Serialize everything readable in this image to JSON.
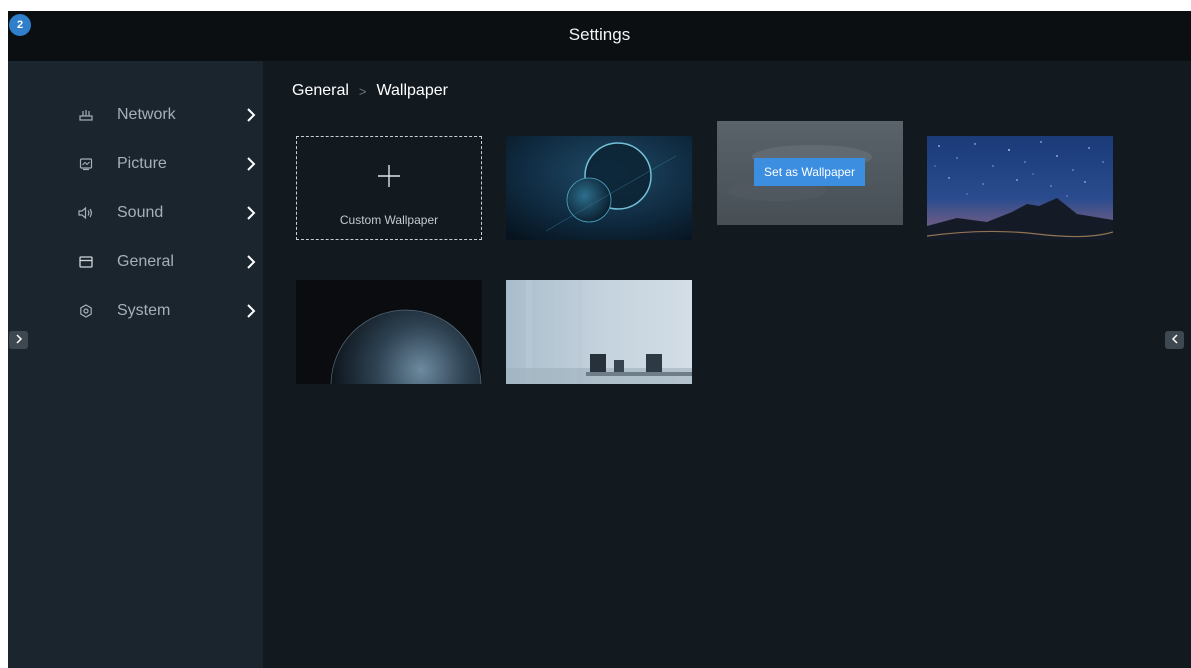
{
  "header": {
    "title": "Settings",
    "badge_count": "2"
  },
  "sidebar": {
    "items": [
      {
        "label": "Network",
        "icon": "network-icon"
      },
      {
        "label": "Picture",
        "icon": "picture-icon"
      },
      {
        "label": "Sound",
        "icon": "sound-icon"
      },
      {
        "label": "General",
        "icon": "general-icon"
      },
      {
        "label": "System",
        "icon": "system-icon"
      }
    ]
  },
  "breadcrumb": {
    "parent": "General",
    "separator": ">",
    "current": "Wallpaper"
  },
  "wallpapers": {
    "custom_label": "Custom Wallpaper",
    "set_label": "Set as Wallpaper",
    "items": [
      {
        "name": "planets-blue",
        "selected": false
      },
      {
        "name": "cloudy-sky",
        "selected": true
      },
      {
        "name": "starry-night-mountain",
        "selected": false
      },
      {
        "name": "earth-from-space",
        "selected": false
      },
      {
        "name": "conference-room",
        "selected": false
      }
    ]
  },
  "colors": {
    "accent": "#3c8ee0",
    "background": "#121a20",
    "sidebar": "#1b252d",
    "titlebar": "#0b0f12"
  }
}
